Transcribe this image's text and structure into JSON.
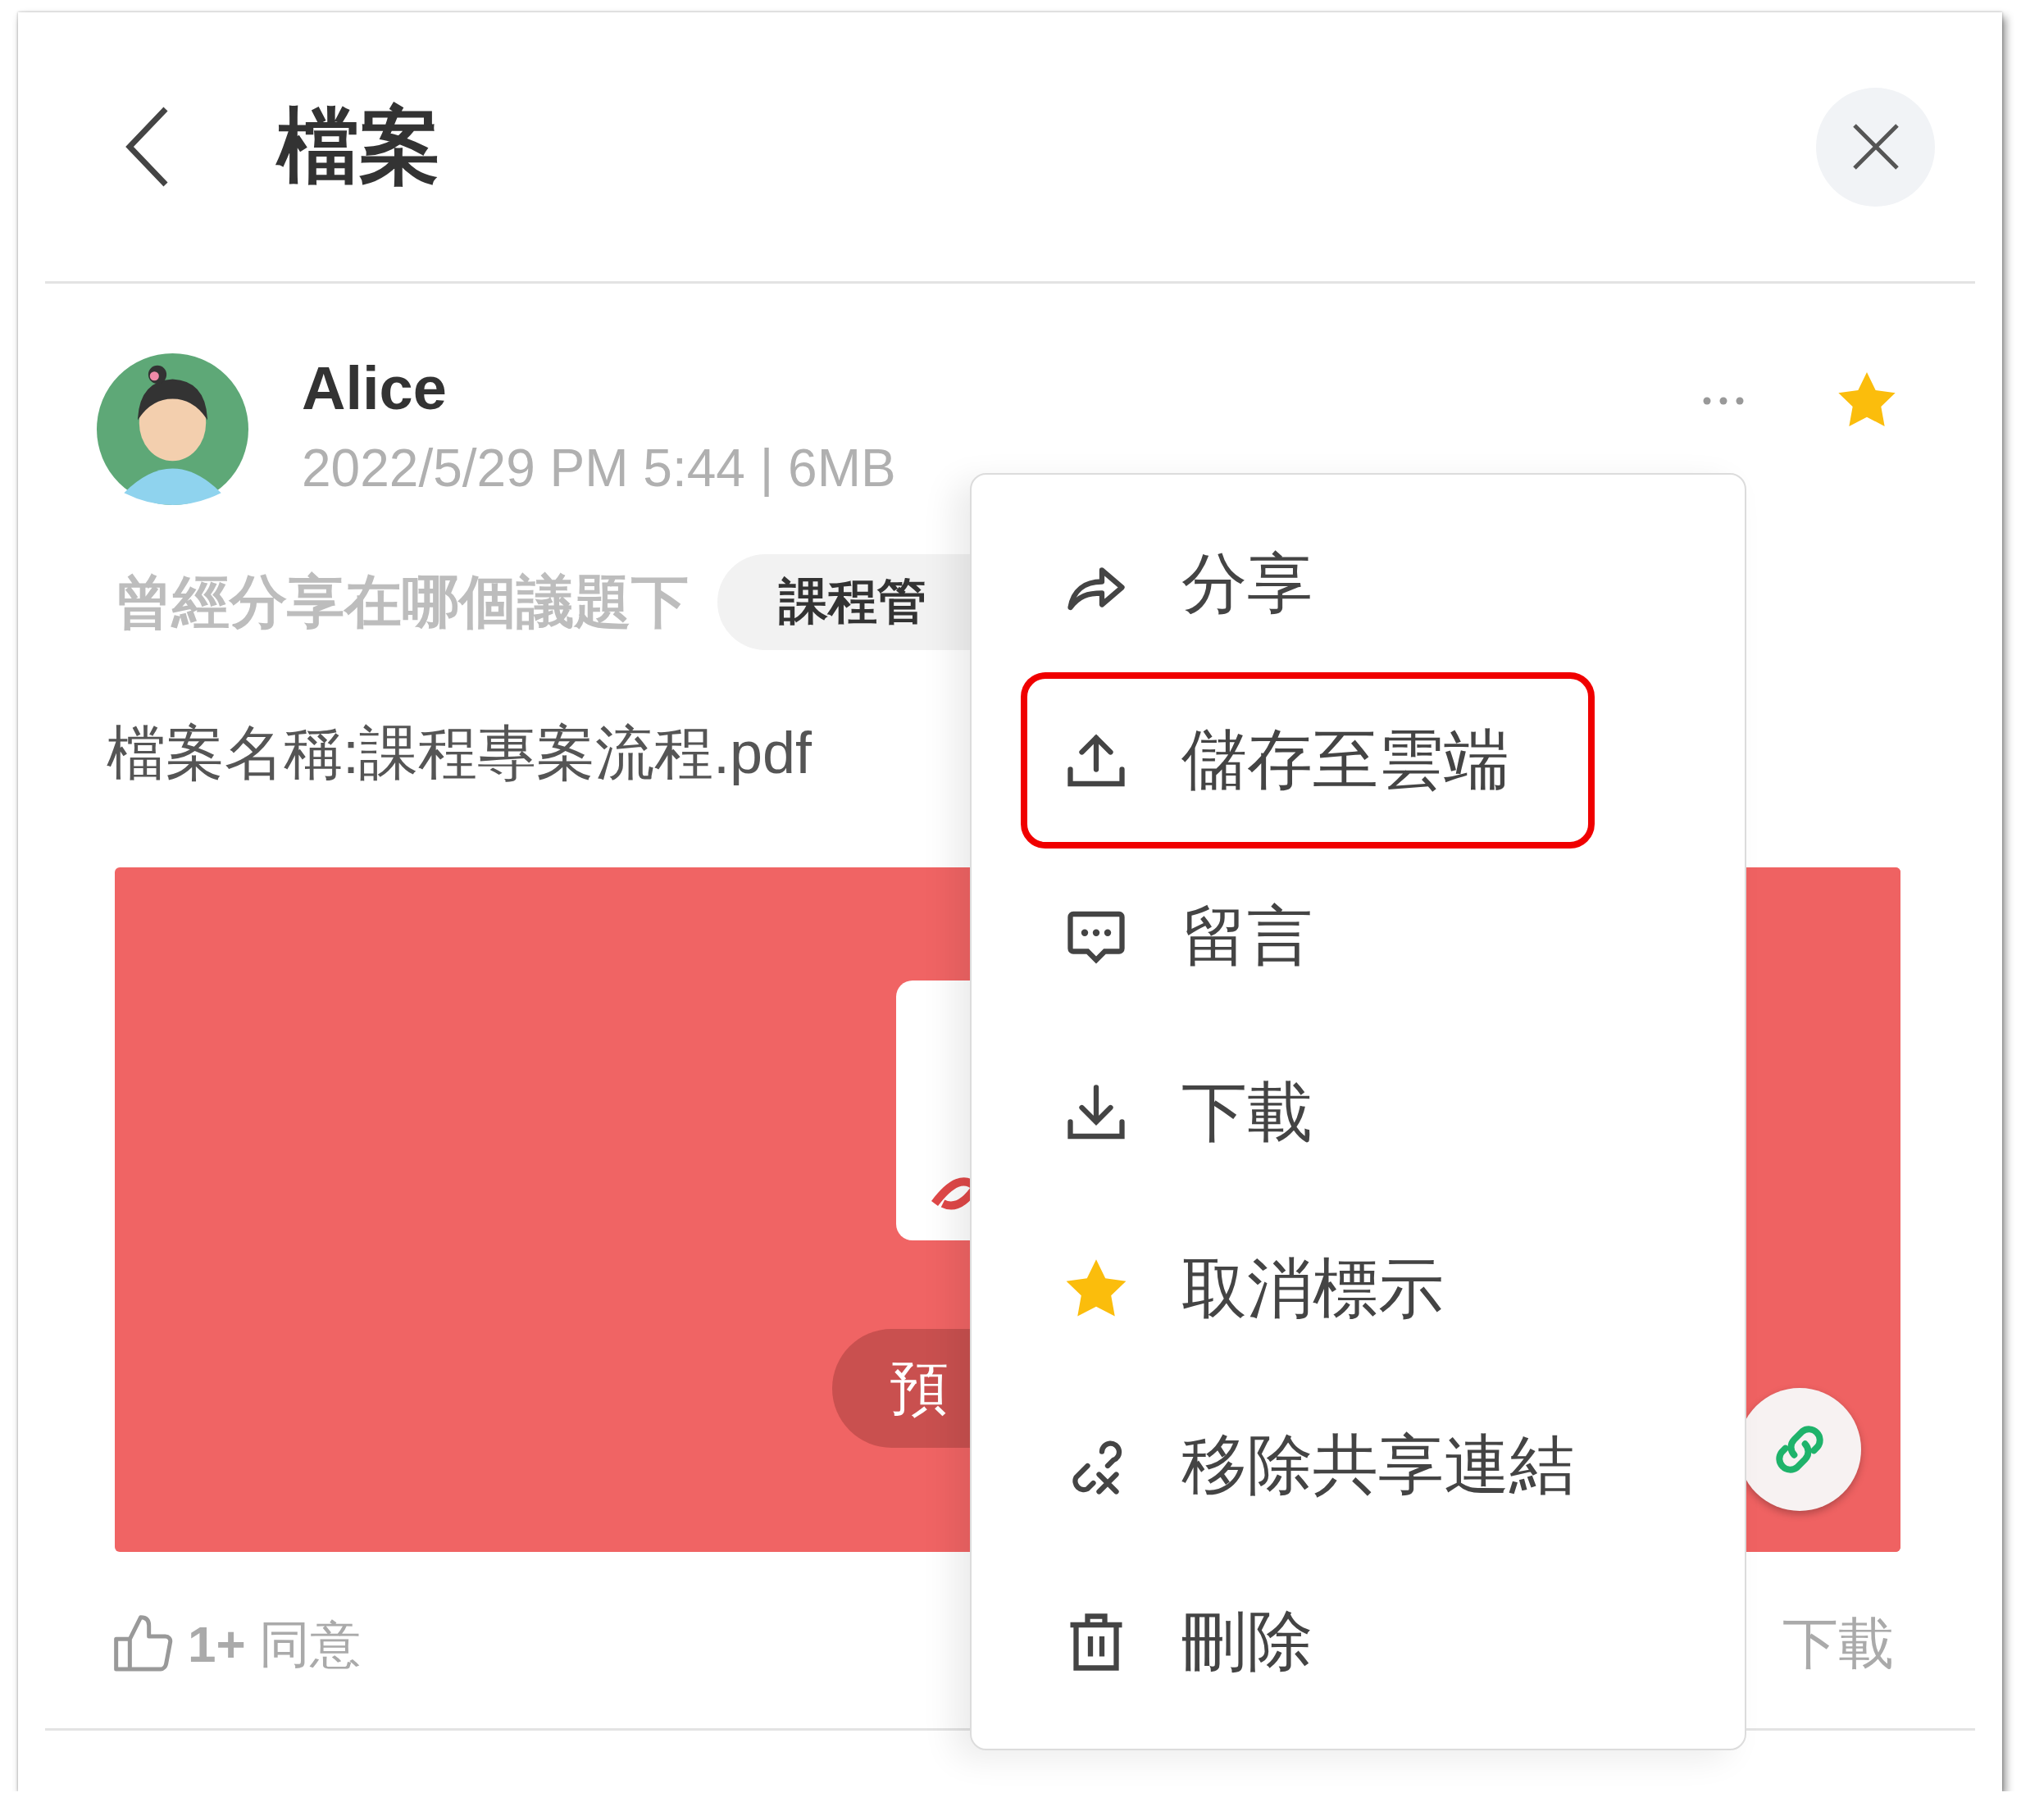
{
  "header": {
    "title": "檔案"
  },
  "post": {
    "author": "Alice",
    "meta": "2022/5/29 PM 5:44 | 6MB",
    "starred": true,
    "topics_label": "曾經分享在哪個議題下",
    "topic_chip": "課程管",
    "file_name": "檔案名稱:課程專案流程.pdf",
    "preview": {
      "kind": "picture",
      "button": "預"
    },
    "likes": {
      "count": "1+",
      "label": "同意"
    },
    "download": "下載"
  },
  "menu": [
    {
      "kind": "share",
      "label": "分享",
      "highlighted": false
    },
    {
      "kind": "upload",
      "label": "儲存至雲端",
      "highlighted": true
    },
    {
      "kind": "comment",
      "label": "留言",
      "highlighted": false
    },
    {
      "kind": "download",
      "label": "下載",
      "highlighted": false
    },
    {
      "kind": "star",
      "label": "取消標示",
      "highlighted": false
    },
    {
      "kind": "unlink",
      "label": "移除共享連結",
      "highlighted": false
    },
    {
      "kind": "trash",
      "label": "刪除",
      "highlighted": false
    }
  ]
}
